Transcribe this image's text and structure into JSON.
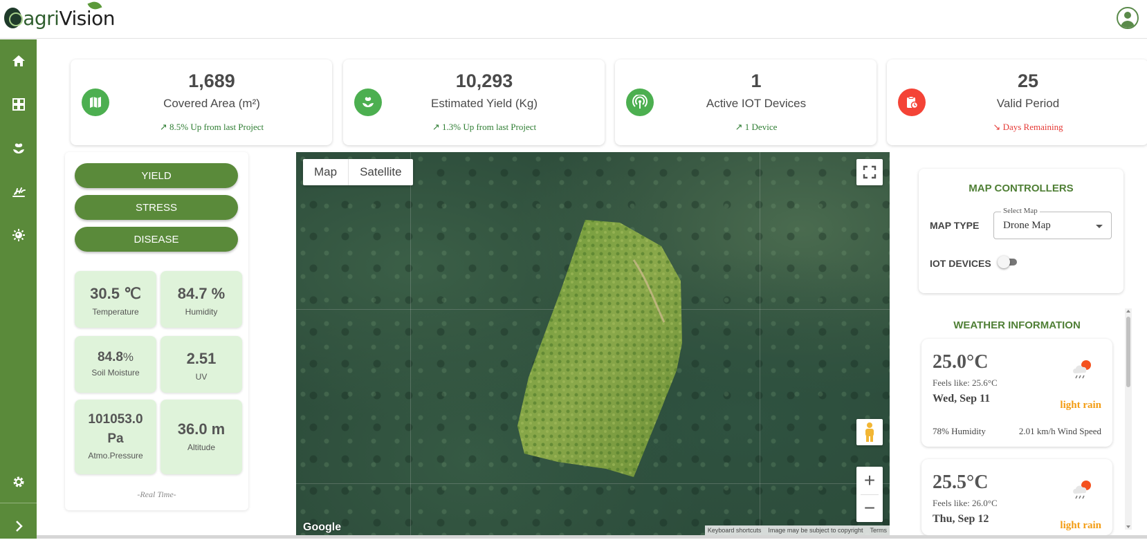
{
  "app": {
    "logo_part1": "agri",
    "logo_part2": "Vision"
  },
  "sidebar": {
    "items": [
      {
        "icon": "home-icon"
      },
      {
        "icon": "dashboard-icon"
      },
      {
        "icon": "plant-icon"
      },
      {
        "icon": "crop-field-icon"
      },
      {
        "icon": "virus-icon"
      },
      {
        "icon": "settings-icon"
      },
      {
        "icon": "chevron-right-icon"
      }
    ]
  },
  "stats": [
    {
      "value": "1,689",
      "label": "Covered Area (m²)",
      "sub": "8.5% Up from last Project",
      "trend": "up",
      "icon": "map-icon",
      "color": "#4caf50"
    },
    {
      "value": "10,293",
      "label": "Estimated Yield (Kg)",
      "sub": "1.3% Up from last Project",
      "trend": "up",
      "icon": "seedling-icon",
      "color": "#4caf50"
    },
    {
      "value": "1",
      "label": "Active IOT Devices",
      "sub": "1 Device",
      "trend": "up",
      "icon": "broadcast-icon",
      "color": "#4caf50"
    },
    {
      "value": "25",
      "label": "Valid Period",
      "sub": "Days Remaining",
      "trend": "down",
      "icon": "clipboard-clock-icon",
      "color": "#f44336"
    }
  ],
  "left_panel": {
    "buttons": [
      "YIELD",
      "STRESS",
      "DISEASE"
    ],
    "metrics": {
      "temperature": {
        "value": "30.5 ℃",
        "label": "Temperature"
      },
      "humidity": {
        "value": "84.7 %",
        "label": "Humidity"
      },
      "soil": {
        "value": "84.8",
        "unit": "%",
        "label": "Soil Moisture"
      },
      "uv": {
        "value": "2.51",
        "label": "UV"
      },
      "pressure": {
        "value": "101053.0",
        "unit": "Pa",
        "label": "Atmo.Pressure"
      },
      "altitude": {
        "value": "36.0 m",
        "label": "Altitude"
      }
    },
    "footer": "-Real Time-"
  },
  "map": {
    "tab_map": "Map",
    "tab_satellite": "Satellite",
    "zoom_in": "+",
    "zoom_out": "−",
    "google": "Google",
    "footer_links": [
      "Keyboard shortcuts",
      "Image may be subject to copyright",
      "Terms"
    ]
  },
  "map_controllers": {
    "title": "MAP CONTROLLERS",
    "map_type_label": "MAP TYPE",
    "select_legend": "Select Map",
    "select_value": "Drone Map",
    "iot_label": "IOT DEVICES"
  },
  "weather": {
    "title": "WEATHER INFORMATION",
    "days": [
      {
        "temp": "25.0°C",
        "feels": "Feels like: 25.6°C",
        "date": "Wed, Sep 11",
        "condition": "light rain",
        "humidity": "78% Humidity",
        "wind": "2.01 km/h Wind Speed"
      },
      {
        "temp": "25.5°C",
        "feels": "Feels like: 26.0°C",
        "date": "Thu, Sep 12",
        "condition": "light rain"
      }
    ]
  }
}
